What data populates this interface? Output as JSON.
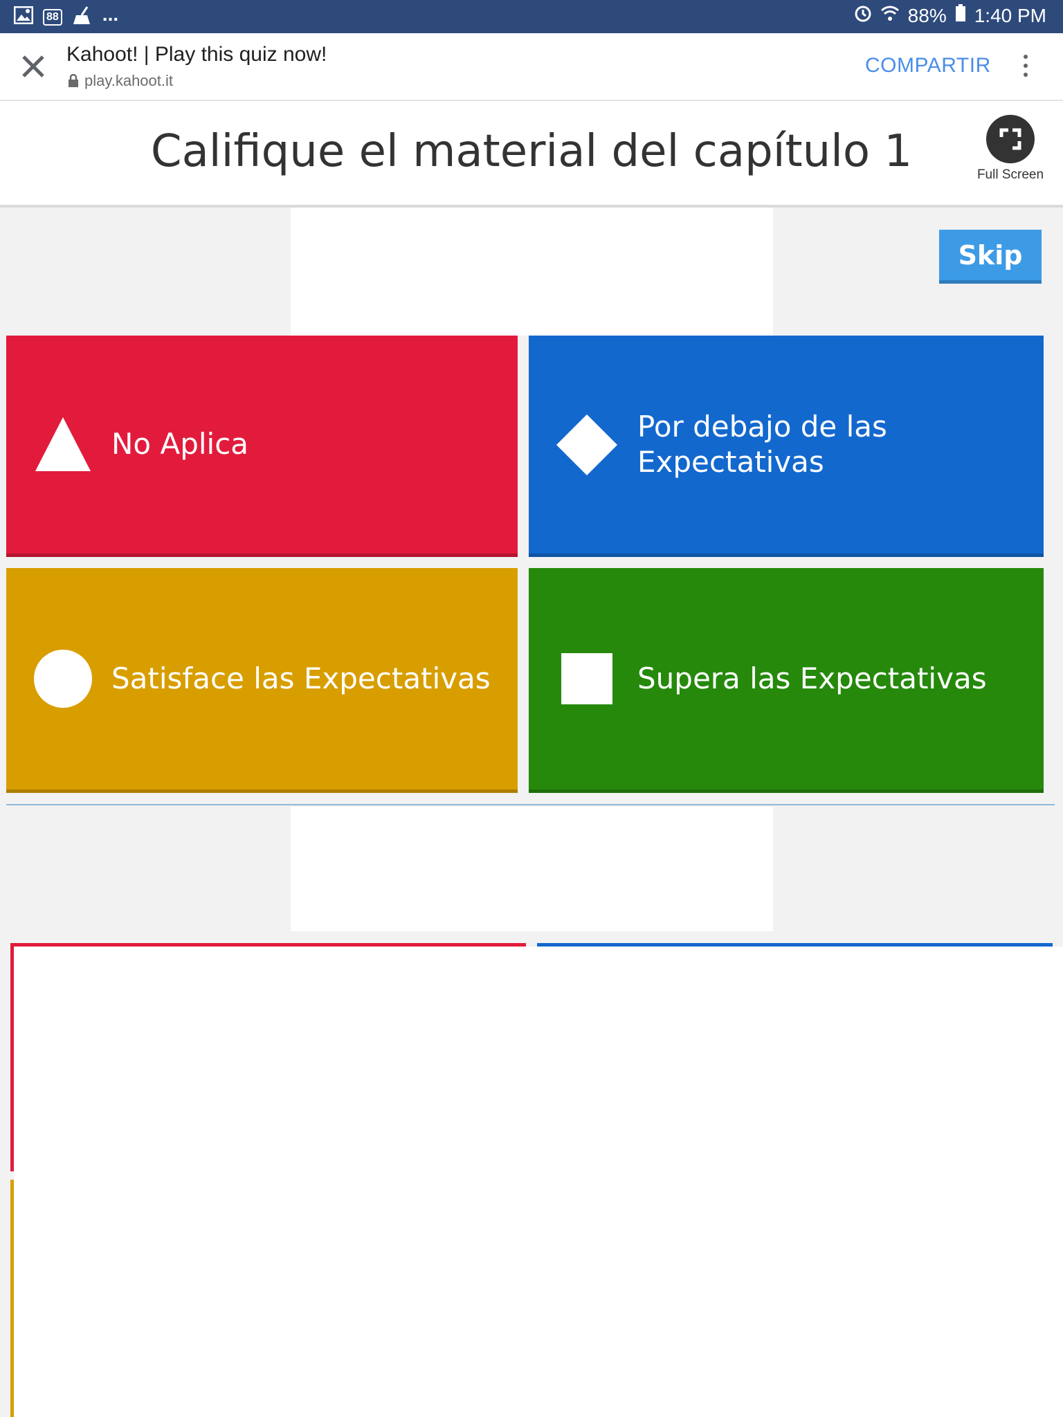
{
  "status_bar": {
    "badge": "88",
    "dots": "...",
    "battery": "88%",
    "time": "1:40 PM"
  },
  "browser": {
    "title": "Kahoot! | Play this quiz now!",
    "url": "play.kahoot.it",
    "share_label": "COMPARTIR"
  },
  "quiz": {
    "title": "Califique el material del capítulo 1",
    "fullscreen_label": "Full Screen",
    "skip_label": "Skip",
    "answers": [
      {
        "label": "No Aplica",
        "color": "#e21b3c",
        "shape": "triangle-icon"
      },
      {
        "label": "Por debajo de las Expectativas",
        "color": "#1368ce",
        "shape": "diamond-icon"
      },
      {
        "label": "Satisface las Expectativas",
        "color": "#d89e00",
        "shape": "circle-icon"
      },
      {
        "label": "Supera las Expectativas",
        "color": "#26890c",
        "shape": "square-icon"
      }
    ]
  }
}
